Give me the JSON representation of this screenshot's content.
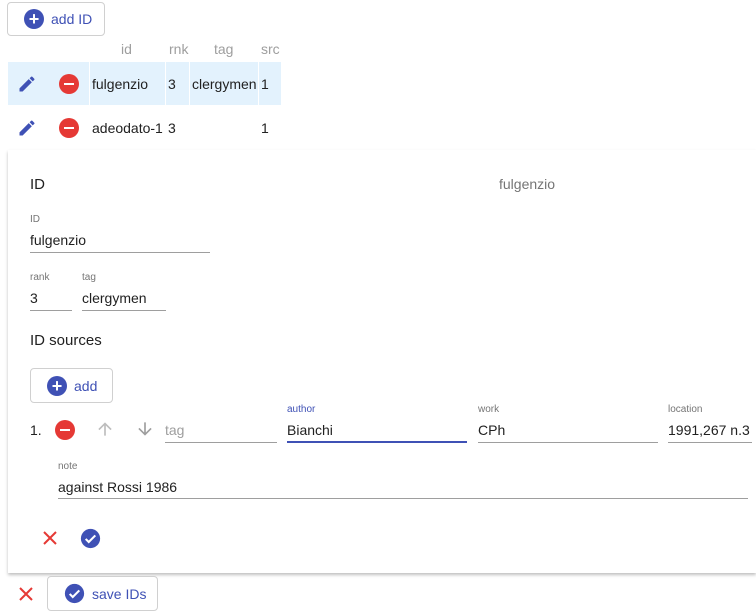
{
  "toolbar": {
    "add_id_label": "add ID"
  },
  "table": {
    "headers": [
      "id",
      "rnk",
      "tag",
      "src"
    ],
    "rows": [
      {
        "id": "fulgenzio",
        "rnk": "3",
        "tag": "clergymen",
        "src": "1",
        "selected": true
      },
      {
        "id": "adeodato-1",
        "rnk": "3",
        "tag": "",
        "src": "1",
        "selected": false
      }
    ]
  },
  "editor": {
    "title": "ID",
    "title_value": "fulgenzio",
    "id_field": {
      "label": "ID",
      "value": "fulgenzio"
    },
    "rank_field": {
      "label": "rank",
      "value": "3"
    },
    "tag_field": {
      "label": "tag",
      "value": "clergymen"
    },
    "sources_heading": "ID sources",
    "add_source_label": "add",
    "source": {
      "number": "1.",
      "tag_placeholder": "tag",
      "author": {
        "label": "author",
        "value": "Bianchi"
      },
      "work": {
        "label": "work",
        "value": "CPh"
      },
      "location": {
        "label": "location",
        "value": "1991,267 n.3"
      },
      "note": {
        "label": "note",
        "value": "against Rossi 1986"
      }
    }
  },
  "footer": {
    "save_label": "save IDs"
  },
  "colors": {
    "primary": "#3f51b5",
    "danger": "#e53935",
    "selected_row": "#e3f2fd"
  },
  "icons": [
    "plus-circle-icon",
    "edit-pencil-icon",
    "remove-circle-icon",
    "arrow-up-icon",
    "arrow-down-icon",
    "close-icon",
    "check-circle-icon"
  ]
}
